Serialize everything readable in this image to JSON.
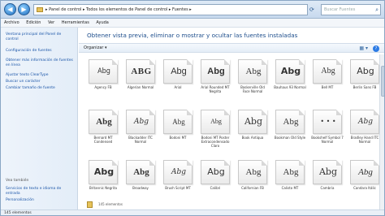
{
  "address": {
    "breadcrumb": "▸ Panel de control ▸ Todos los elementos de Panel de control ▸ Fuentes ▸",
    "search_placeholder": "Buscar Fuentes"
  },
  "menu": [
    "Archivo",
    "Edición",
    "Ver",
    "Herramientas",
    "Ayuda"
  ],
  "nav": {
    "items": [
      "Ventana principal del Panel de control",
      "Configuración de fuentes",
      "Obtener más información de fuentes en línea",
      "Ajustar texto ClearType",
      "Buscar un carácter",
      "Cambiar tamaño de fuente"
    ],
    "see_also": "Vea también",
    "bottom_items": [
      "Servicios de texto e idioma de entrada",
      "Personalización"
    ]
  },
  "content": {
    "heading": "Obtener vista previa, eliminar o mostrar y ocultar las fuentes instaladas",
    "organize": "Organizar ▾",
    "help": "?"
  },
  "fonts": [
    {
      "glyph": "Abg",
      "name": "Agency FB"
    },
    {
      "glyph": "ABG",
      "name": "Algerian Normal"
    },
    {
      "glyph": "Abg",
      "name": "Arial"
    },
    {
      "glyph": "Abg",
      "name": "Arial Rounded MT Negrita"
    },
    {
      "glyph": "Abg",
      "name": "Baskerville Old Face Normal"
    },
    {
      "glyph": "Abg",
      "name": "Bauhaus 93 Normal"
    },
    {
      "glyph": "Abg",
      "name": "Bell MT"
    },
    {
      "glyph": "Abg",
      "name": "Berlin Sans FB"
    },
    {
      "glyph": "Abg",
      "name": "Bernard MT Condensed"
    },
    {
      "glyph": "Abg",
      "name": "Blackadder ITC Normal"
    },
    {
      "glyph": "Abg",
      "name": "Bodoni MT"
    },
    {
      "glyph": "Abg",
      "name": "Bodoni MT Poster Extracondensado Claro"
    },
    {
      "glyph": "Abg",
      "name": "Book Antiqua"
    },
    {
      "glyph": "Abg",
      "name": "Bookman Old Style"
    },
    {
      "glyph": "• • •",
      "name": "Bookshelf Symbol 7 Normal"
    },
    {
      "glyph": "Abg",
      "name": "Bradley Hand ITC Normal"
    },
    {
      "glyph": "Abg",
      "name": "Britannic Negrita"
    },
    {
      "glyph": "Abg",
      "name": "Broadway"
    },
    {
      "glyph": "Abg",
      "name": "Brush Script MT"
    },
    {
      "glyph": "Abg",
      "name": "Calibri"
    },
    {
      "glyph": "Abg",
      "name": "Californian FB"
    },
    {
      "glyph": "Abg",
      "name": "Calisto MT"
    },
    {
      "glyph": "Abg",
      "name": "Cambria"
    },
    {
      "glyph": "Abg",
      "name": "Candara Itálic"
    }
  ],
  "lowbar": "145 elementos",
  "status": "145 elementos"
}
